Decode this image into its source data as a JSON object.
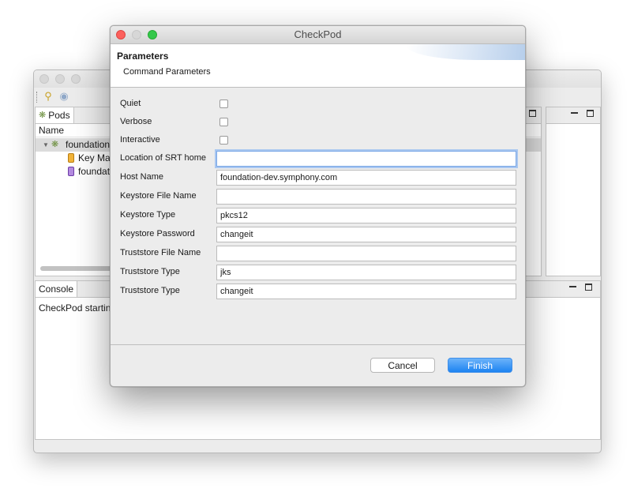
{
  "dialog": {
    "title": "CheckPod",
    "header_title": "Parameters",
    "header_subtitle": "Command Parameters",
    "fields": [
      {
        "label": "Quiet",
        "type": "checkbox",
        "checked": false
      },
      {
        "label": "Verbose",
        "type": "checkbox",
        "checked": false
      },
      {
        "label": "Interactive",
        "type": "checkbox",
        "checked": false
      },
      {
        "label": "Location of SRT home",
        "type": "text",
        "value": "",
        "focused": true
      },
      {
        "label": "Host Name",
        "type": "text",
        "value": "foundation-dev.symphony.com"
      },
      {
        "label": "Keystore File Name",
        "type": "text",
        "value": ""
      },
      {
        "label": "Keystore Type",
        "type": "text",
        "value": "pkcs12"
      },
      {
        "label": "Keystore Password",
        "type": "text",
        "value": "changeit"
      },
      {
        "label": "Truststore File Name",
        "type": "text",
        "value": ""
      },
      {
        "label": "Truststore Type",
        "type": "text",
        "value": "jks"
      },
      {
        "label": "Truststore Type",
        "type": "text",
        "value": "changeit"
      }
    ],
    "cancel_label": "Cancel",
    "finish_label": "Finish",
    "accent_color": "#1d83f1"
  },
  "main_window": {
    "pods_tab_label": "Pods",
    "pods_column_header": "Name",
    "tree_items": [
      {
        "label": "foundation"
      },
      {
        "label": "Key Mar"
      },
      {
        "label": "foundat"
      }
    ],
    "console_tab_label": "Console",
    "console_text": "CheckPod startin"
  }
}
